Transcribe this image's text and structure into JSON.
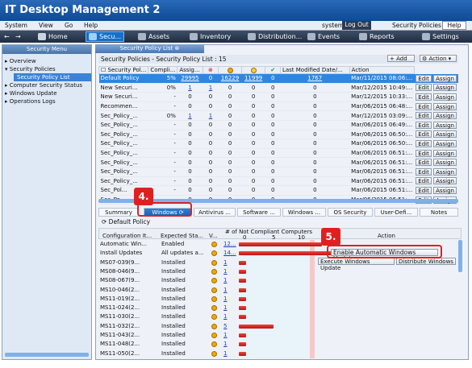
{
  "app": {
    "title": "IT Desktop Management 2"
  },
  "menu": {
    "items": [
      "System",
      "View",
      "Go",
      "Help"
    ],
    "user": "system",
    "logout": "Log Out",
    "security_policies": "Security Policies",
    "help": "Help"
  },
  "toolbar": {
    "home": "Home",
    "security": "Secu...",
    "assets": "Assets",
    "inventory": "Inventory",
    "distribution": "Distribution...",
    "events": "Events",
    "reports": "Reports",
    "settings": "Settings"
  },
  "sidebar": {
    "header": "Security Menu",
    "items": [
      "Overview",
      "Security Policies",
      "Security Policy List",
      "Computer Security Status",
      "Windows Update",
      "Operations Logs"
    ]
  },
  "main": {
    "tab": "Security Policy List",
    "list_title": "Security Policies - Security Policy List : 15",
    "add_label": "Add",
    "action_label": "Action",
    "columns": [
      "Security Pol...",
      "Compli...",
      "Assig...",
      "",
      "",
      "",
      "",
      "Last Modified Date/...",
      "Action"
    ],
    "rows": [
      [
        "Default Policy",
        "5%",
        "29995",
        "0",
        "16229",
        "11999",
        "0",
        "1767",
        "Mar/11/2015 08:06:..."
      ],
      [
        "New Securi...",
        "0%",
        "1",
        "1",
        "0",
        "0",
        "0",
        "0",
        "Mar/12/2015 10:49:..."
      ],
      [
        "New Securi...",
        "-",
        "0",
        "0",
        "0",
        "0",
        "0",
        "0",
        "Mar/12/2015 10:33:..."
      ],
      [
        "Recommen...",
        "-",
        "0",
        "0",
        "0",
        "0",
        "0",
        "0",
        "Mar/06/2015 06:48:..."
      ],
      [
        "Sec_Policy_...",
        "0%",
        "1",
        "1",
        "0",
        "0",
        "0",
        "0",
        "Mar/12/2015 03:09:..."
      ],
      [
        "Sec_Policy_...",
        "-",
        "0",
        "0",
        "0",
        "0",
        "0",
        "0",
        "Mar/06/2015 06:49:..."
      ],
      [
        "Sec_Policy_...",
        "-",
        "0",
        "0",
        "0",
        "0",
        "0",
        "0",
        "Mar/06/2015 06:50:..."
      ],
      [
        "Sec_Policy_...",
        "-",
        "0",
        "0",
        "0",
        "0",
        "0",
        "0",
        "Mar/06/2015 06:50:..."
      ],
      [
        "Sec_Policy_...",
        "-",
        "0",
        "0",
        "0",
        "0",
        "0",
        "0",
        "Mar/06/2015 06:51:..."
      ],
      [
        "Sec_Policy_...",
        "-",
        "0",
        "0",
        "0",
        "0",
        "0",
        "0",
        "Mar/06/2015 06:51:..."
      ],
      [
        "Sec_Policy_...",
        "-",
        "0",
        "0",
        "0",
        "0",
        "0",
        "0",
        "Mar/06/2015 06:51:..."
      ],
      [
        "Sec_Policy_...",
        "-",
        "0",
        "0",
        "0",
        "0",
        "0",
        "0",
        "Mar/06/2015 06:51:..."
      ],
      [
        "Sec_Pol...",
        "-",
        "0",
        "0",
        "0",
        "0",
        "0",
        "0",
        "Mar/06/2015 06:51:..."
      ],
      [
        "Sec_Po...",
        "-",
        "0",
        "0",
        "0",
        "0",
        "0",
        "0",
        "Mar/06/2015 06:51:..."
      ]
    ],
    "edit": "Edit",
    "assign": "Assign"
  },
  "detail": {
    "tabs": [
      "Summary",
      "Windows",
      "Antivirus ...",
      "Software ...",
      "Windows ...",
      "OS Security",
      "User-Defi...",
      "Notes"
    ],
    "policy": "Default Policy",
    "columns": [
      "Configuration It...",
      "Expected Sta...",
      "V...",
      "# of Not Compliant Computers",
      "Action"
    ],
    "axis": [
      "0",
      "5",
      "10"
    ],
    "rows": [
      {
        "item": "Automatic Win...",
        "status": "Enabled",
        "count": "12...",
        "value": 12
      },
      {
        "item": "Install Updates",
        "status": "All updates a...",
        "count": "14...",
        "value": 14
      },
      {
        "item": "MS07-039(9...",
        "status": "Installed",
        "count": "1",
        "value": 1
      },
      {
        "item": "MS08-046(9...",
        "status": "Installed",
        "count": "1",
        "value": 1
      },
      {
        "item": "MS08-067(9...",
        "status": "Installed",
        "count": "1",
        "value": 1
      },
      {
        "item": "MS10-046(2...",
        "status": "Installed",
        "count": "1",
        "value": 1
      },
      {
        "item": "MS11-019(2...",
        "status": "Installed",
        "count": "1",
        "value": 1
      },
      {
        "item": "MS11-024(2...",
        "status": "Installed",
        "count": "1",
        "value": 1
      },
      {
        "item": "MS11-030(2...",
        "status": "Installed",
        "count": "1",
        "value": 1
      },
      {
        "item": "MS11-032(2...",
        "status": "Installed",
        "count": "5",
        "value": 5
      },
      {
        "item": "MS11-043(2...",
        "status": "Installed",
        "count": "1",
        "value": 1
      },
      {
        "item": "MS11-048(2...",
        "status": "Installed",
        "count": "1",
        "value": 1
      },
      {
        "item": "MS11-050(2...",
        "status": "Installed",
        "count": "1",
        "value": 1
      }
    ],
    "btn_enable": "Enable Automatic Windows Update",
    "btn_execute": "Execute Windows Update",
    "btn_distribute": "Distribute Windows"
  },
  "callouts": {
    "four": "4.",
    "five": "5."
  }
}
